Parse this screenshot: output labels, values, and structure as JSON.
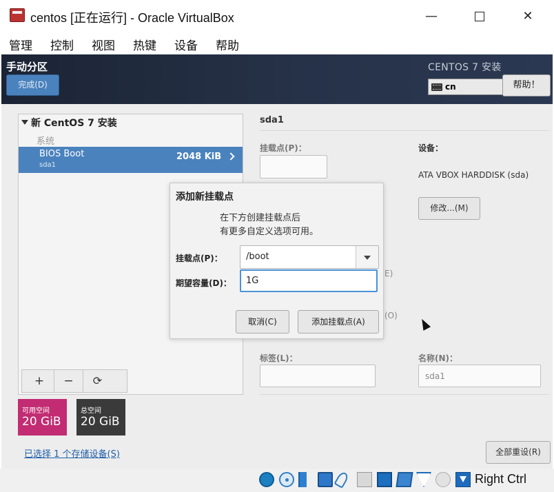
{
  "window": {
    "title": "centos [正在运行] - Oracle VirtualBox",
    "minimize": "—",
    "close": "✕"
  },
  "menu": [
    "管理",
    "控制",
    "视图",
    "热键",
    "设备",
    "帮助"
  ],
  "installer": {
    "page_title": "手动分区",
    "done_label": "完成(D)",
    "install_title": "CENTOS 7 安装",
    "keyboard_layout": "cn",
    "help_label": "帮助！"
  },
  "left_panel": {
    "tree_header": "新 CentOS 7 安装",
    "system_label": "系统",
    "partition": {
      "name": "BIOS Boot",
      "device": "sda1",
      "size": "2048 KiB"
    },
    "toolbar": {
      "add": "+",
      "remove": "−",
      "refresh": "⟳"
    }
  },
  "space": {
    "available_label": "可用空间",
    "available_value": "20 GiB",
    "total_label": "总空间",
    "total_value": "20 GiB",
    "storage_link": "已选择 1 个存储设备(S)"
  },
  "right_panel": {
    "heading": "sda1",
    "mount_point_label": "挂载点(P)：",
    "device_label": "设备：",
    "device_value": "ATA VBOX HARDDISK (sda)",
    "modify_label": "修改...(M)",
    "partial_e": "E)",
    "partial_o": "(O)",
    "tag_label": "标签(L)：",
    "name_label": "名称(N)：",
    "name_value": "sda1",
    "reset_all_label": "全部重设(R)"
  },
  "dialog": {
    "title": "添加新挂载点",
    "desc_line1": "在下方创建挂载点后",
    "desc_line2": "有更多自定义选项可用。",
    "mount_label": "挂载点(P)：",
    "mount_value": "/boot",
    "capacity_label": "期望容量(D)：",
    "capacity_value": "1G",
    "cancel_label": "取消(C)",
    "add_label": "添加挂载点(A)"
  },
  "statusbar": {
    "host_key": "Right Ctrl"
  }
}
